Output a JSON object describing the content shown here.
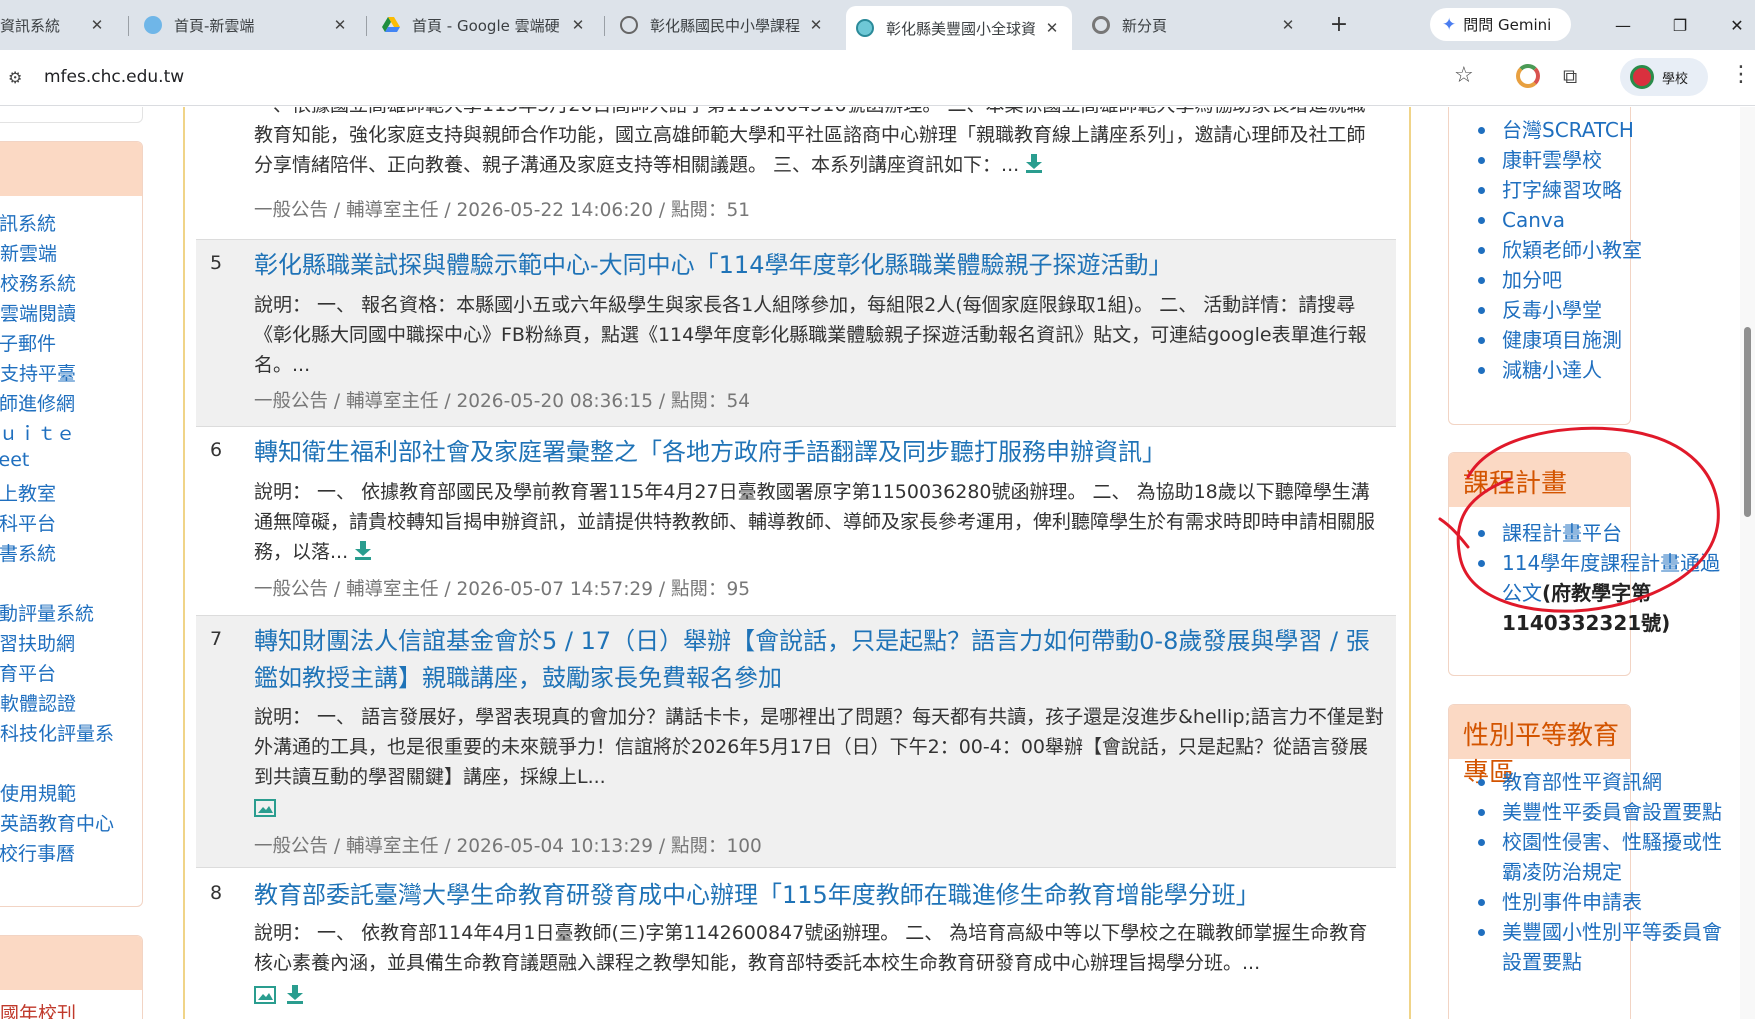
{
  "browser": {
    "tabs": [
      {
        "label": "資訊系統",
        "favicon": "generic-page-icon"
      },
      {
        "label": "首頁-新雲端",
        "favicon": "cloud-icon"
      },
      {
        "label": "首頁 - Google 雲端硬",
        "favicon": "google-drive-icon"
      },
      {
        "label": "彰化縣國民中小學課程",
        "favicon": "globe-icon"
      },
      {
        "label": "彰化縣美豐國小全球資",
        "favicon": "school-icon"
      },
      {
        "label": "新分頁",
        "favicon": "chrome-icon"
      }
    ],
    "new_tab": "+",
    "gemini_label": "問問 Gemini",
    "url": "mfes.chc.edu.tw",
    "profile_label": "學校"
  },
  "left_sidebar": {
    "links": [
      "資訊系統",
      "教育新雲端",
      "雲端校務系統",
      "智慧雲端閱讀",
      "電子郵件",
      "家長支持平臺",
      "教師進修網",
      "ｓｕｉｔｅ",
      "meet",
      "線上教室",
      "學科平台",
      "圖書系統",
      "運動評量系統",
      "學習扶助網",
      "教育平台",
      "正版軟體認證",
      "科學科技化評量系",
      "網站使用規範",
      "國際英語教育中心",
      "學校行事曆"
    ],
    "bottom_link": "美豐國年校刊"
  },
  "news": [
    {
      "body": "一、依據國立高雄師範大學115年5月20日高師大諮字第1151004516號函辦理。 二、本案係國立高雄師範大學為協助家長增進親職教育知能，強化家庭支持與親師合作功能，國立高雄師範大學和平社區諮商中心辦理「親職教育線上講座系列」，邀請心理師及社工師分享情緒陪伴、正向教養、親子溝通及家庭支持等相關議題。 三、本系列講座資訊如下：...",
      "meta": "一般公告 / 輔導室主任 / 2026-05-22 14:06:20 / 點閱：51"
    },
    {
      "num": "5",
      "title": "彰化縣職業試探與體驗示範中心-大同中心「114學年度彰化縣職業體驗親子探遊活動」",
      "body": "說明： 一、 報名資格：本縣國小五或六年級學生與家長各1人組隊參加，每組限2人(每個家庭限錄取1組)。 二、 活動詳情：請搜尋《彰化縣大同國中職探中心》FB粉絲頁，點選《114學年度彰化縣職業體驗親子探遊活動報名資訊》貼文，可連結google表單進行報名。...",
      "meta": "一般公告 / 輔導室主任 / 2026-05-20 08:36:15 / 點閱：54"
    },
    {
      "num": "6",
      "title": "轉知衛生福利部社會及家庭署彙整之「各地方政府手語翻譯及同步聽打服務申辦資訊」",
      "body": "說明： 一、 依據教育部國民及學前教育署115年4月27日臺教國署原字第1150036280號函辦理。 二、 為協助18歲以下聽障學生溝通無障礙，請貴校轉知旨揭申辦資訊，並請提供特教教師、輔導教師、導師及家長參考運用，俾利聽障學生於有需求時即時申請相關服務，以落...",
      "meta": "一般公告 / 輔導室主任 / 2026-05-07 14:57:29 / 點閱：95"
    },
    {
      "num": "7",
      "title": "轉知財團法人信誼基金會於5 / 17（日）舉辦【會說話，只是起點？語言力如何帶動0-8歲發展與學習 / 張鑑如教授主講】親職講座，鼓勵家長免費報名參加",
      "body": "說明： 一、 語言發展好，學習表現真的會加分？講話卡卡，是哪裡出了問題？每天都有共讀，孩子還是沒進步&hellip;語言力不僅是對外溝通的工具，也是很重要的未來競爭力！信誼將於2026年5月17日（日）下午2：00-4：00舉辦【會說話，只是起點？從語言發展到共讀互動的學習關鍵】講座，採線上L...",
      "meta": "一般公告 / 輔導室主任 / 2026-05-04 10:13:29 / 點閱：100"
    },
    {
      "num": "8",
      "title": "教育部委託臺灣大學生命教育研發育成中心辦理「115年度教師在職進修生命教育增能學分班」",
      "body": "說明： 一、 依教育部114年4月1日臺教師(三)字第1142600847號函辦理。 二、 為培育高級中等以下學校之在職教師掌握生命教育核心素養內涵，並具備生命教育議題融入課程之教學知能，教育部特委託本校生命教育研發育成中心辦理旨揭學分班。..."
    }
  ],
  "right_sidebar": {
    "top_links": [
      "台灣SCRATCH",
      "康軒雲學校",
      "打字練習攻略",
      "Canva",
      "欣穎老師小教室",
      "加分吧",
      "反毒小學堂",
      "健康項目施測",
      "減糖小達人"
    ],
    "curriculum": {
      "title": "課程計畫",
      "links": [
        "課程計畫平台"
      ],
      "approval_link": "114學年度課程計畫通過公文",
      "approval_note": "(府教學字第1140332321號)"
    },
    "gender": {
      "title": "性別平等教育專區",
      "links": [
        "教育部性平資訊網",
        "美豐性平委員會設置要點",
        "校園性侵害、性騷擾或性霸凌防治規定",
        "性別事件申請表",
        "美豐國小性別平等委員會設置要點"
      ]
    }
  },
  "colors": {
    "link": "#1f6fbf",
    "title_link": "#1f73b7",
    "panel_header": "#fbd9c4",
    "panel_title": "#d35400",
    "annotation": "#e0192a"
  }
}
